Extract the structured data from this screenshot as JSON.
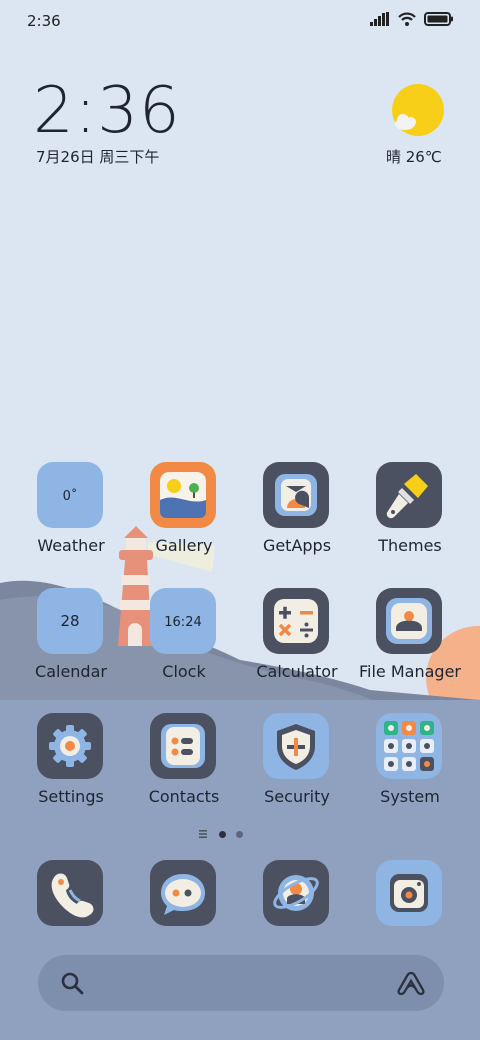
{
  "status_bar": {
    "time": "2:36"
  },
  "clock_widget": {
    "time": "2:36",
    "date": "7月26日 周三下午"
  },
  "weather_widget": {
    "condition_temp": "晴 26℃"
  },
  "apps": [
    {
      "label": "Weather",
      "icon": "weather-icon",
      "icon_text": "0˚"
    },
    {
      "label": "Gallery",
      "icon": "gallery-icon"
    },
    {
      "label": "GetApps",
      "icon": "getapps-icon"
    },
    {
      "label": "Themes",
      "icon": "themes-icon"
    },
    {
      "label": "Calendar",
      "icon": "calendar-icon",
      "icon_text": "28"
    },
    {
      "label": "Clock",
      "icon": "clock-icon",
      "icon_text": "16:24"
    },
    {
      "label": "Calculator",
      "icon": "calculator-icon"
    },
    {
      "label": "File Manager",
      "icon": "file-manager-icon"
    },
    {
      "label": "Settings",
      "icon": "settings-icon"
    },
    {
      "label": "Contacts",
      "icon": "contacts-icon"
    },
    {
      "label": "Security",
      "icon": "security-icon"
    },
    {
      "label": "System",
      "icon": "system-folder-icon"
    }
  ],
  "dock": [
    {
      "name": "phone",
      "icon": "phone-icon"
    },
    {
      "name": "messages",
      "icon": "messages-icon"
    },
    {
      "name": "browser",
      "icon": "browser-icon"
    },
    {
      "name": "camera",
      "icon": "camera-icon"
    }
  ],
  "colors": {
    "sky": "#dce6f2",
    "hills": "#7b879e",
    "ground": "#8fa1bf",
    "icon_dark": "#4b5160",
    "icon_light": "#8fb5e4",
    "accent_orange": "#f28a45",
    "sun_yellow": "#f8cf18"
  }
}
